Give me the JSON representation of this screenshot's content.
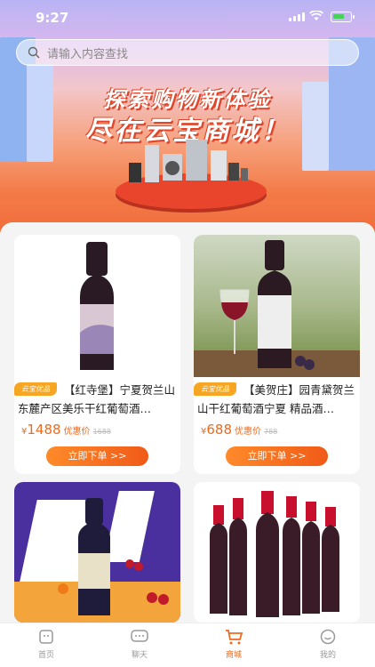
{
  "status_bar": {
    "time": "9:27"
  },
  "search": {
    "placeholder": "请输入内容查找"
  },
  "banner": {
    "line1": "探索购物新体验",
    "line2": "尽在云宝商城！"
  },
  "products": [
    {
      "tag": "云宝优品",
      "title": "【红寺堡】宁夏贺兰山东麓产区美乐干红葡萄酒…",
      "currency": "¥",
      "price": "1488",
      "price_label": "优惠价",
      "original_price": "1688",
      "button": "立即下单 >>"
    },
    {
      "tag": "云宝优品",
      "title": "【美贺庄】园青黛贺兰山干红葡萄酒宁夏 精品酒…",
      "currency": "¥",
      "price": "688",
      "price_label": "优惠价",
      "original_price": "788",
      "button": "立即下单 >>"
    },
    {
      "tag": "",
      "title": "",
      "currency": "",
      "price": "",
      "price_label": "",
      "original_price": "",
      "button": ""
    },
    {
      "tag": "",
      "title": "",
      "currency": "",
      "price": "",
      "price_label": "",
      "original_price": "",
      "button": ""
    }
  ],
  "tabbar": {
    "active_color": "#f06a1c",
    "items": [
      {
        "label": "首页",
        "icon": "home-icon"
      },
      {
        "label": "聊天",
        "icon": "chat-icon"
      },
      {
        "label": "商城",
        "icon": "cart-icon"
      },
      {
        "label": "我的",
        "icon": "profile-icon"
      }
    ]
  }
}
